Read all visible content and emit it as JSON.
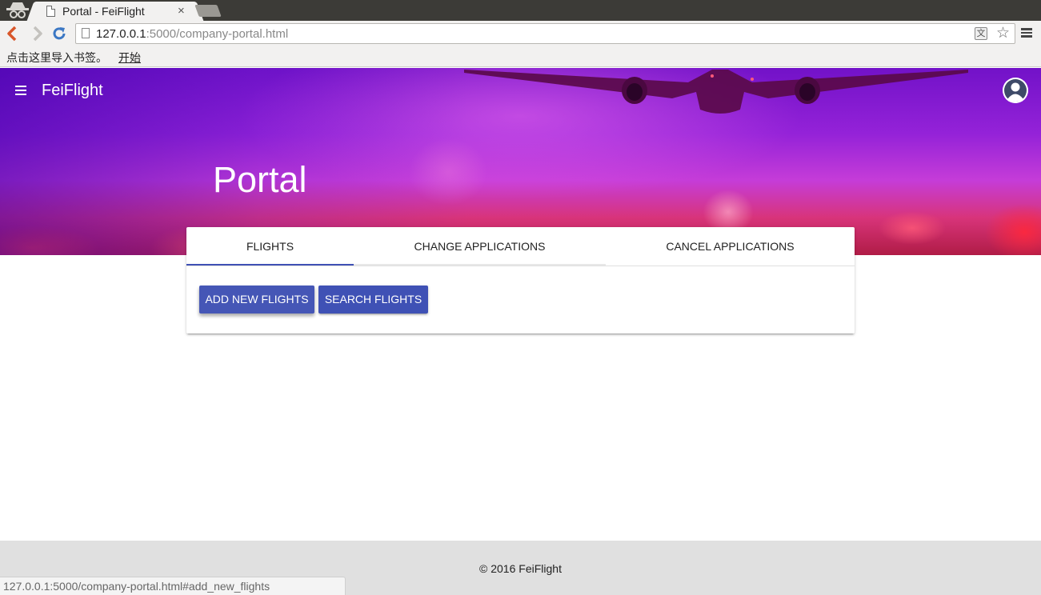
{
  "browser": {
    "tab_title": "Portal - FeiFlight",
    "tab_close": "×",
    "url_host": "127.0.0.1",
    "url_rest": ":5000/company-portal.html",
    "bookmarks_prompt": "点击这里导入书签。",
    "bookmarks_start": "开始",
    "status_url": "127.0.0.1:5000/company-portal.html#add_new_flights",
    "icons": {
      "back": "back-arrow-icon",
      "forward": "forward-arrow-icon",
      "reload": "reload-icon",
      "star": "bookmark-star-icon",
      "menu": "hamburger-menu-icon",
      "translate": "translate-icon"
    }
  },
  "app": {
    "brand": "FeiFlight",
    "hero_title": "Portal",
    "tabs": [
      {
        "label": "FLIGHTS",
        "active": true
      },
      {
        "label": "CHANGE APPLICATIONS",
        "active": false
      },
      {
        "label": "CANCEL APPLICATIONS",
        "active": false
      }
    ],
    "buttons": {
      "add_new_flights": "ADD NEW FLIGHTS",
      "search_flights": "SEARCH FLIGHTS"
    },
    "footer": "© 2016 FeiFlight",
    "colors": {
      "primary": "#3f51b5",
      "footer_bg": "#e0e0e0"
    }
  }
}
